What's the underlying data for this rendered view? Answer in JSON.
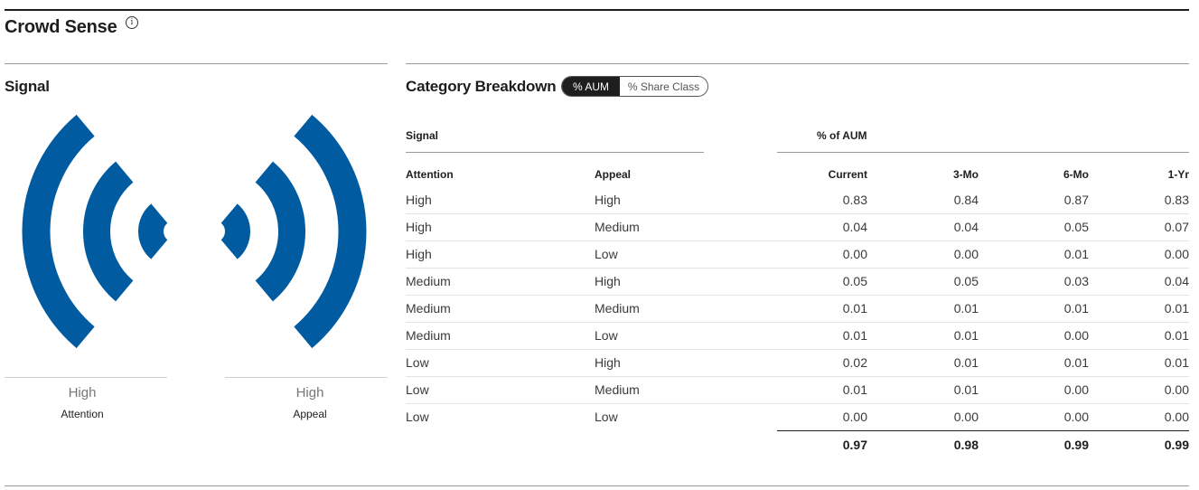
{
  "header": {
    "title": "Crowd Sense",
    "info_icon": "info-icon"
  },
  "signal": {
    "heading": "Signal",
    "attention": {
      "value": "High",
      "label": "Attention"
    },
    "appeal": {
      "value": "High",
      "label": "Appeal"
    },
    "arc_color": "#005ba1"
  },
  "breakdown": {
    "heading": "Category Breakdown",
    "toggle": {
      "active": "% AUM",
      "inactive": "% Share Class"
    },
    "group_headers": {
      "signal": "Signal",
      "aum": "% of AUM"
    },
    "columns": [
      "Attention",
      "Appeal",
      "Current",
      "3-Mo",
      "6-Mo",
      "1-Yr"
    ],
    "rows": [
      [
        "High",
        "High",
        "0.83",
        "0.84",
        "0.87",
        "0.83"
      ],
      [
        "High",
        "Medium",
        "0.04",
        "0.04",
        "0.05",
        "0.07"
      ],
      [
        "High",
        "Low",
        "0.00",
        "0.00",
        "0.01",
        "0.00"
      ],
      [
        "Medium",
        "High",
        "0.05",
        "0.05",
        "0.03",
        "0.04"
      ],
      [
        "Medium",
        "Medium",
        "0.01",
        "0.01",
        "0.01",
        "0.01"
      ],
      [
        "Medium",
        "Low",
        "0.01",
        "0.01",
        "0.00",
        "0.01"
      ],
      [
        "Low",
        "High",
        "0.02",
        "0.01",
        "0.01",
        "0.01"
      ],
      [
        "Low",
        "Medium",
        "0.01",
        "0.01",
        "0.00",
        "0.00"
      ],
      [
        "Low",
        "Low",
        "0.00",
        "0.00",
        "0.00",
        "0.00"
      ]
    ],
    "totals": [
      "0.97",
      "0.98",
      "0.99",
      "0.99"
    ]
  }
}
